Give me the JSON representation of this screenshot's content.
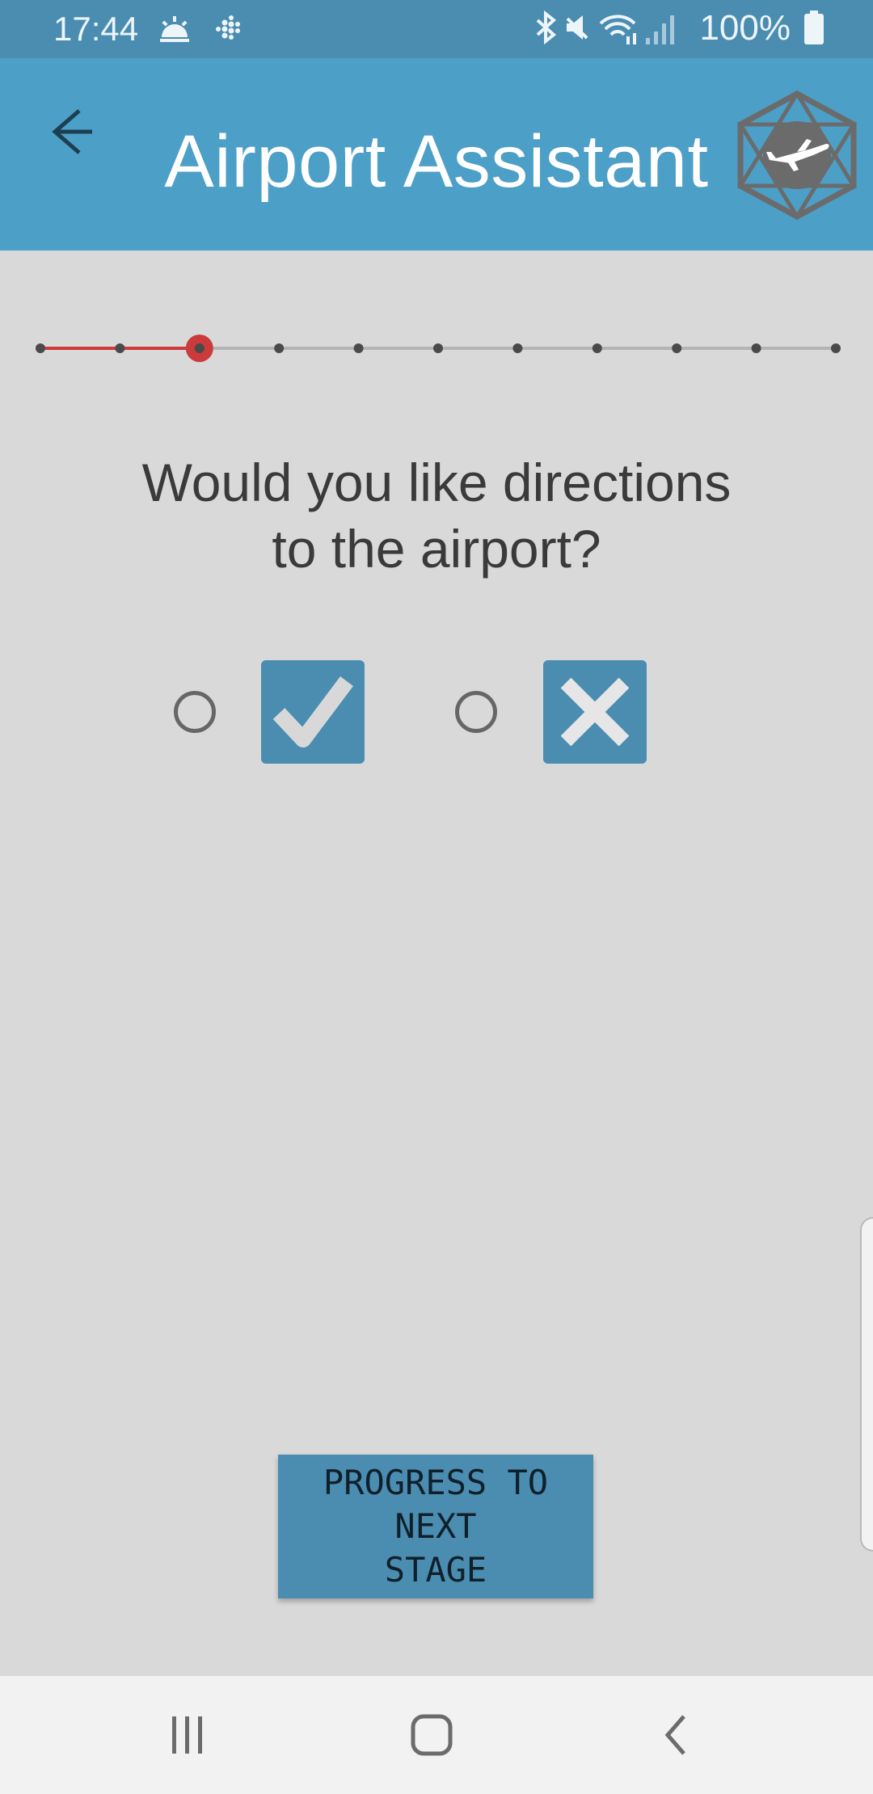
{
  "status_bar": {
    "time": "17:44",
    "battery": "100%",
    "left_icons": [
      "weather-sunrise-icon",
      "fitbit-icon"
    ],
    "right_icons": [
      "bluetooth-icon",
      "mute-icon",
      "wifi-icon",
      "signal-icon",
      "battery-icon"
    ]
  },
  "app_bar": {
    "title": "Airport Assistant",
    "back_icon": "arrow-left-icon",
    "logo_icon": "airplane-hexagon-logo"
  },
  "progress": {
    "total_steps": 11,
    "current_step": 3,
    "completed_color": "#cc3b3b",
    "remaining_color": "#b4b4b4"
  },
  "question": {
    "line1": "Would you like directions",
    "line2": "to the airport?"
  },
  "options": [
    {
      "name": "yes",
      "icon": "checkmark-icon",
      "selected": false
    },
    {
      "name": "no",
      "icon": "cross-icon",
      "selected": false
    }
  ],
  "next_button": {
    "line1": "PROGRESS TO NEXT",
    "line2": "STAGE"
  },
  "nav_bar": {
    "buttons": [
      "recent-apps-icon",
      "home-icon",
      "back-icon"
    ]
  },
  "colors": {
    "status_bar": "#4a8db1",
    "app_bar": "#4c9fc7",
    "background": "#d9d9d9",
    "tile": "#4a8db1"
  }
}
